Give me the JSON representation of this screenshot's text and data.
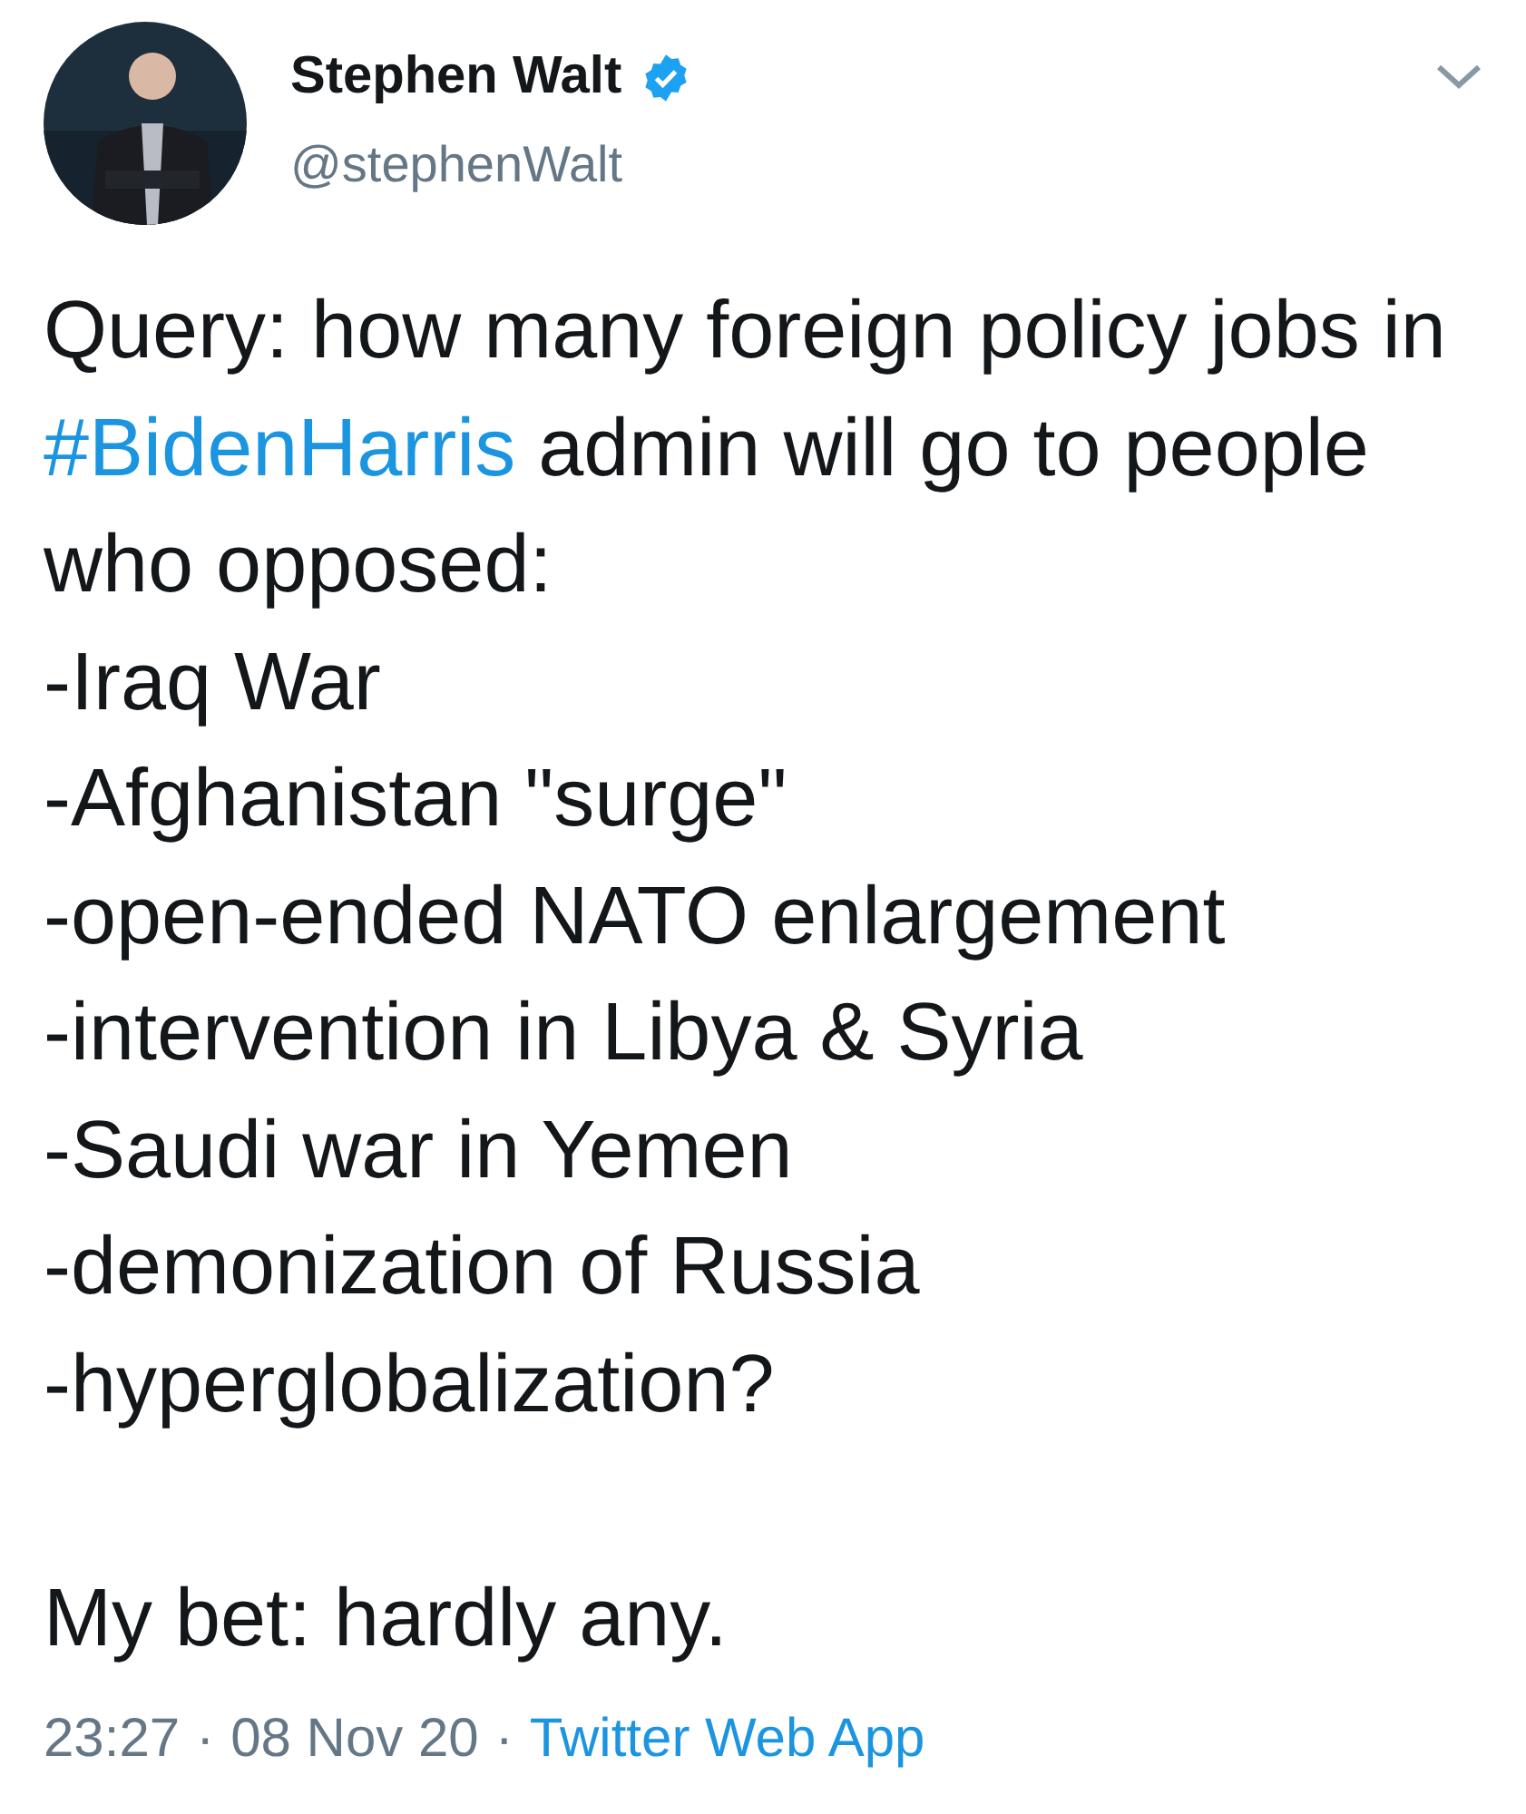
{
  "author": {
    "name": "Stephen Walt",
    "verified": true,
    "handle": "@stephenWalt"
  },
  "tweet": {
    "query_start": "Query: how many foreign policy jobs in",
    "hashtag": "#BidenHarris",
    "query_end": "admin will go to people who opposed:",
    "list_items": [
      "-Iraq War",
      "-Afghanistan \"surge\"",
      "-open-ended NATO enlargement",
      "-intervention in Libya & Syria",
      "-Saudi war in Yemen",
      "-demonization of Russia",
      "-hyperglobalization?"
    ],
    "closing": "My bet: hardly any."
  },
  "meta": {
    "time": "23:27",
    "separator_1": "·",
    "date": "08 Nov 20",
    "separator_2": "·",
    "source": "Twitter Web App"
  }
}
